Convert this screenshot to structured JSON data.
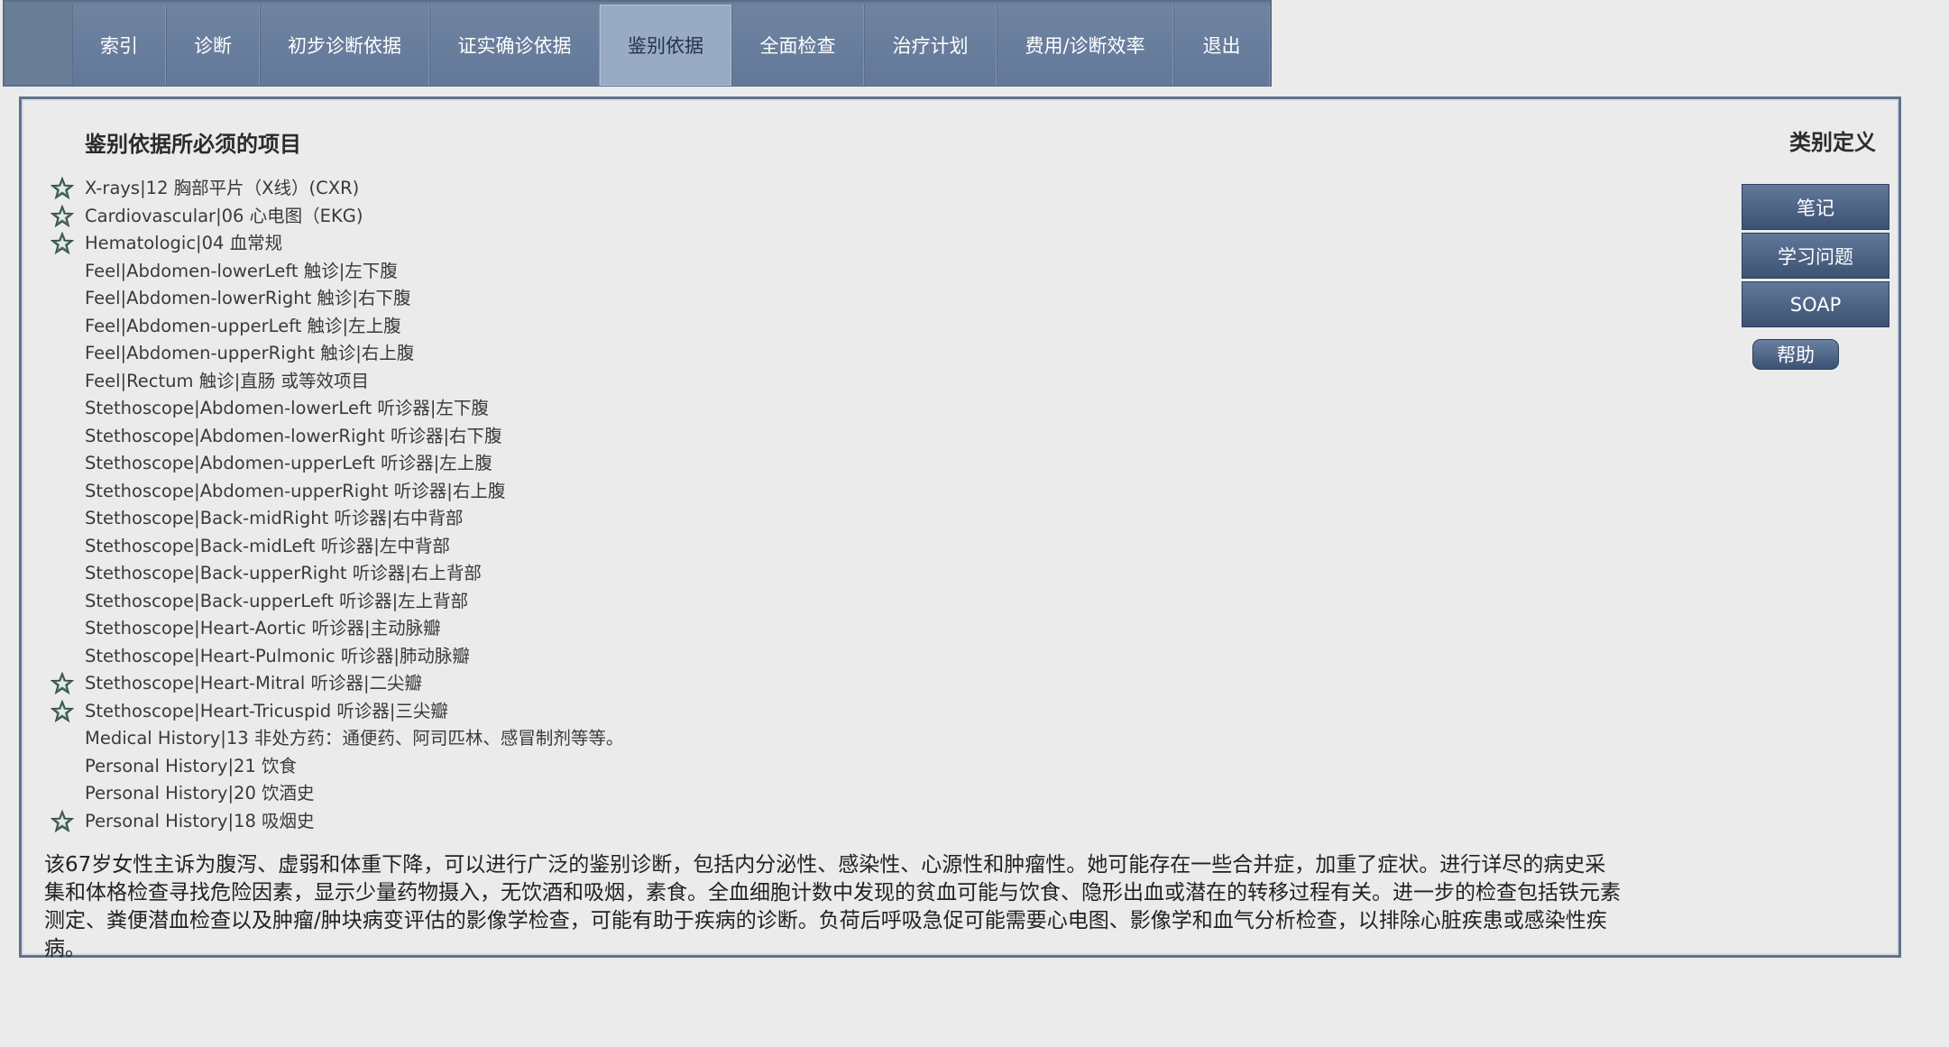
{
  "nav": {
    "tabs": [
      {
        "label": "索引",
        "width": 104
      },
      {
        "label": "诊断",
        "width": 104
      },
      {
        "label": "初步诊断依据",
        "width": 188
      },
      {
        "label": "证实确诊依据",
        "width": 189
      },
      {
        "label": "鉴别依据",
        "width": 146
      },
      {
        "label": "全面检查",
        "width": 147
      },
      {
        "label": "治疗计划",
        "width": 147
      },
      {
        "label": "费用/诊断效率",
        "width": 196
      },
      {
        "label": "退出",
        "width": 107
      }
    ],
    "active_tab": "鉴别依据"
  },
  "panel": {
    "title": "鉴别依据所必须的项目",
    "category_definition_label": "类别定义",
    "items": [
      {
        "label": "X-rays|12 胸部平片（X线）(CXR)",
        "starred": true
      },
      {
        "label": "Cardiovascular|06 心电图（EKG)",
        "starred": true
      },
      {
        "label": "Hematologic|04 血常规",
        "starred": true
      },
      {
        "label": "Feel|Abdomen-lowerLeft 触诊|左下腹",
        "starred": false
      },
      {
        "label": "Feel|Abdomen-lowerRight 触诊|右下腹",
        "starred": false
      },
      {
        "label": "Feel|Abdomen-upperLeft 触诊|左上腹",
        "starred": false
      },
      {
        "label": "Feel|Abdomen-upperRight 触诊|右上腹",
        "starred": false
      },
      {
        "label": "Feel|Rectum 触诊|直肠 或等效项目",
        "starred": false
      },
      {
        "label": "Stethoscope|Abdomen-lowerLeft 听诊器|左下腹",
        "starred": false
      },
      {
        "label": "Stethoscope|Abdomen-lowerRight 听诊器|右下腹",
        "starred": false
      },
      {
        "label": "Stethoscope|Abdomen-upperLeft 听诊器|左上腹",
        "starred": false
      },
      {
        "label": "Stethoscope|Abdomen-upperRight 听诊器|右上腹",
        "starred": false
      },
      {
        "label": "Stethoscope|Back-midRight 听诊器|右中背部",
        "starred": false
      },
      {
        "label": "Stethoscope|Back-midLeft 听诊器|左中背部",
        "starred": false
      },
      {
        "label": "Stethoscope|Back-upperRight 听诊器|右上背部",
        "starred": false
      },
      {
        "label": "Stethoscope|Back-upperLeft 听诊器|左上背部",
        "starred": false
      },
      {
        "label": "Stethoscope|Heart-Aortic 听诊器|主动脉瓣",
        "starred": false
      },
      {
        "label": "Stethoscope|Heart-Pulmonic 听诊器|肺动脉瓣",
        "starred": false
      },
      {
        "label": "Stethoscope|Heart-Mitral 听诊器|二尖瓣",
        "starred": true
      },
      {
        "label": "Stethoscope|Heart-Tricuspid 听诊器|三尖瓣",
        "starred": true
      },
      {
        "label": "Medical History|13 非处方药：通便药、阿司匹林、感冒制剂等等。",
        "starred": false
      },
      {
        "label": "Personal History|21 饮食",
        "starred": false
      },
      {
        "label": "Personal History|20 饮酒史",
        "starred": false
      },
      {
        "label": "Personal History|18 吸烟史",
        "starred": true
      }
    ],
    "summary": "该67岁女性主诉为腹泻、虚弱和体重下降，可以进行广泛的鉴别诊断，包括内分泌性、感染性、心源性和肿瘤性。她可能存在一些合并症，加重了症状。进行详尽的病史采集和体格检查寻找危险因素，显示少量药物摄入，无饮酒和吸烟，素食。全血细胞计数中发现的贫血可能与饮食、隐形出血或潜在的转移过程有关。进一步的检查包括铁元素测定、粪便潜血检查以及肿瘤/肿块病变评估的影像学检查，可能有助于疾病的诊断。负荷后呼吸急促可能需要心电图、影像学和血气分析检查，以排除心脏疾患或感染性疾病。"
  },
  "side": {
    "buttons": [
      "笔记",
      "学习问题",
      "SOAP"
    ],
    "help_label": "帮助"
  },
  "colors": {
    "nav_bg": "#6a7e98",
    "nav_active": "#98aac4",
    "button_dark": "#3c5272",
    "star": "#3e5a52"
  }
}
